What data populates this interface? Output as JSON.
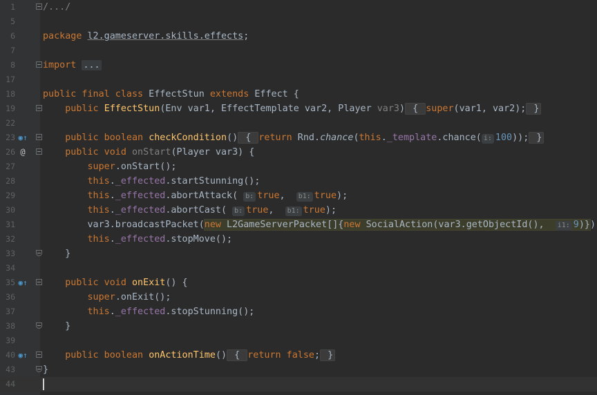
{
  "editor": {
    "lines": [
      {
        "n": "1",
        "code": "<span class=\"dim\">/.../</span>",
        "fold": "start"
      },
      {
        "n": "5",
        "code": "",
        "fold": ""
      },
      {
        "n": "6",
        "code": "<span class=\"kw\">package</span> <span class=\"uline\">l2.gameserver.skills.effects</span>;",
        "fold": ""
      },
      {
        "n": "7",
        "code": "",
        "fold": ""
      },
      {
        "n": "8",
        "code": "<span class=\"kw\">import</span> <span class=\"fold-text\">...</span>",
        "fold": "start"
      },
      {
        "n": "17",
        "code": "",
        "fold": ""
      },
      {
        "n": "18",
        "code": "<span class=\"kw\">public final class</span> EffectStun <span class=\"kw\">extends</span> Effect {",
        "fold": ""
      },
      {
        "n": "19",
        "code": "    <span class=\"kw\">public</span> <span class=\"fn\">EffectStun</span>(Env var1, EffectTemplate var2, Player <span class=\"dim\">var3</span>)<span class=\"brace\"> { </span><span class=\"kw\">super</span>(var1, var2);<span class=\"brace\"> }</span>",
        "fold": "start"
      },
      {
        "n": "22",
        "code": "",
        "fold": ""
      },
      {
        "n": "23",
        "code": "    <span class=\"kw\">public boolean</span> <span class=\"fn\">checkCondition</span>()<span class=\"brace\"> { </span><span class=\"kw\">return</span> Rnd.<span class=\"it\">chance</span>(<span class=\"kw\">this</span>.<span class=\"fld\">_template</span>.chance(<span class=\"hint\">i:</span><span class=\"num\">100</span>));<span class=\"brace\"> }</span>",
        "fold": "start",
        "icon": "o"
      },
      {
        "n": "26",
        "code": "    <span class=\"kw\">public void</span> <span class=\"dim\">onStart</span>(Player var3) {",
        "fold": "start",
        "icon": "at"
      },
      {
        "n": "27",
        "code": "        <span class=\"kw\">super</span>.onStart();",
        "fold": ""
      },
      {
        "n": "28",
        "code": "        <span class=\"kw\">this</span>.<span class=\"fld\">_effected</span>.startStunning();",
        "fold": ""
      },
      {
        "n": "29",
        "code": "        <span class=\"kw\">this</span>.<span class=\"fld\">_effected</span>.abortAttack( <span class=\"hint\">b:</span><span class=\"kw\">true</span>,  <span class=\"hint\">b1:</span><span class=\"kw\">true</span>);",
        "fold": ""
      },
      {
        "n": "30",
        "code": "        <span class=\"kw\">this</span>.<span class=\"fld\">_effected</span>.abortCast( <span class=\"hint\">b:</span><span class=\"kw\">true</span>,  <span class=\"hint\">b1:</span><span class=\"kw\">true</span>);",
        "fold": ""
      },
      {
        "n": "31",
        "code": "        var3.broadcastPacket(<span class=\"hl\"><span class=\"kw\">new</span> L2GameServerPacket[]{<span class=\"kw\">new</span> SocialAction(var3.getObjectId(),  <span class=\"hint\">i1:</span><span class=\"num\">9</span>)}</span>);",
        "fold": ""
      },
      {
        "n": "32",
        "code": "        <span class=\"kw\">this</span>.<span class=\"fld\">_effected</span>.stopMove();",
        "fold": ""
      },
      {
        "n": "33",
        "code": "    }",
        "fold": "end"
      },
      {
        "n": "34",
        "code": "",
        "fold": ""
      },
      {
        "n": "35",
        "code": "    <span class=\"kw\">public void</span> <span class=\"fn\">onExit</span>() {",
        "fold": "start",
        "icon": "o"
      },
      {
        "n": "36",
        "code": "        <span class=\"kw\">super</span>.onExit();",
        "fold": ""
      },
      {
        "n": "37",
        "code": "        <span class=\"kw\">this</span>.<span class=\"fld\">_effected</span>.stopStunning();",
        "fold": ""
      },
      {
        "n": "38",
        "code": "    }",
        "fold": "end"
      },
      {
        "n": "39",
        "code": "",
        "fold": ""
      },
      {
        "n": "40",
        "code": "    <span class=\"kw\">public boolean</span> <span class=\"fn\">onActionTime</span>()<span class=\"brace\"> { </span><span class=\"kw\">return false</span>;<span class=\"brace\"> }</span>",
        "fold": "start",
        "icon": "o"
      },
      {
        "n": "43",
        "code": "}",
        "fold": "end"
      },
      {
        "n": "44",
        "code": "",
        "fold": "",
        "caret": true
      }
    ]
  }
}
